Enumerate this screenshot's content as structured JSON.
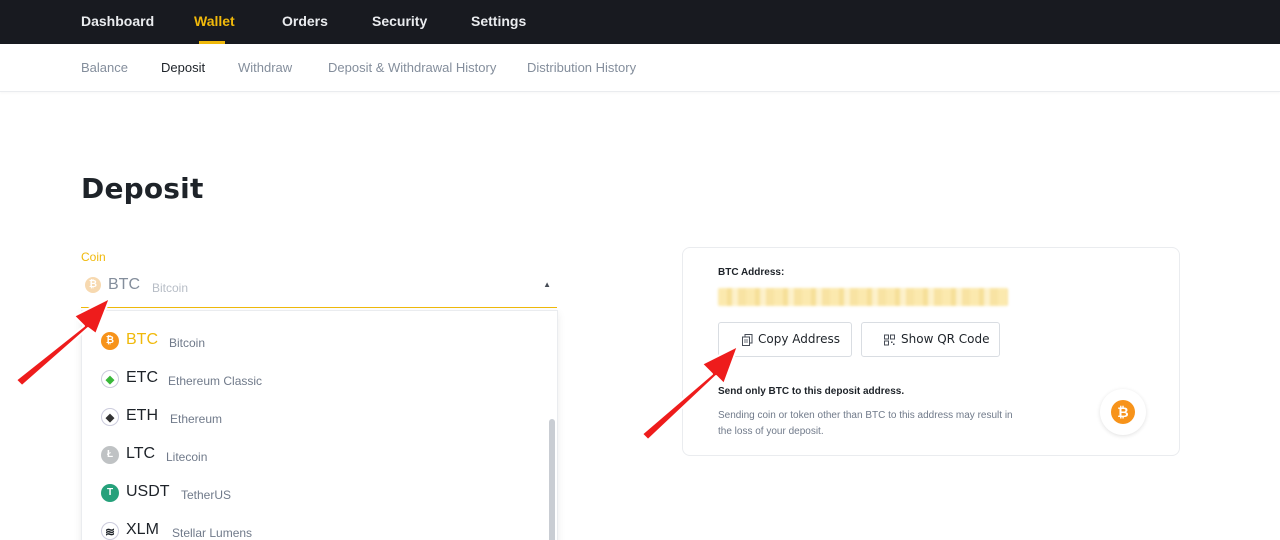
{
  "topnav": {
    "items": [
      {
        "label": "Dashboard"
      },
      {
        "label": "Wallet"
      },
      {
        "label": "Orders"
      },
      {
        "label": "Security"
      },
      {
        "label": "Settings"
      }
    ],
    "active": "Wallet"
  },
  "subnav": {
    "items": [
      {
        "label": "Balance"
      },
      {
        "label": "Deposit"
      },
      {
        "label": "Withdraw"
      },
      {
        "label": "Deposit & Withdrawal History"
      },
      {
        "label": "Distribution History"
      }
    ],
    "active": "Deposit"
  },
  "page": {
    "title": "Deposit"
  },
  "coin_select": {
    "label": "Coin",
    "selected_symbol": "BTC",
    "selected_name": "Bitcoin"
  },
  "coin_options": [
    {
      "symbol": "BTC",
      "name": "Bitcoin",
      "icon": "bitcoin-icon",
      "glyph": "₿",
      "color": "#f7931a"
    },
    {
      "symbol": "ETC",
      "name": "Ethereum Classic",
      "icon": "ethereum-classic-icon",
      "glyph": "◆",
      "color": "#3ab83a"
    },
    {
      "symbol": "ETH",
      "name": "Ethereum",
      "icon": "ethereum-icon",
      "glyph": "◆",
      "color": "#343434"
    },
    {
      "symbol": "LTC",
      "name": "Litecoin",
      "icon": "litecoin-icon",
      "glyph": "Ł",
      "color": "#a6a9aa"
    },
    {
      "symbol": "USDT",
      "name": "TetherUS",
      "icon": "tether-icon",
      "glyph": "T",
      "color": "#26a17b"
    },
    {
      "symbol": "XLM",
      "name": "Stellar Lumens",
      "icon": "stellar-icon",
      "glyph": "≋",
      "color": "#14b6e7"
    }
  ],
  "address_card": {
    "label": "BTC Address:",
    "copy_button": "Copy Address",
    "qr_button": "Show QR Code",
    "warning_title": "Send only BTC to this deposit address.",
    "warning_body": "Sending coin or token other than BTC to this address may result in the loss of your deposit."
  },
  "colors": {
    "accent": "#f0b90b",
    "topnav_bg": "#181a20",
    "annotation_arrow": "#ee1c1c"
  }
}
